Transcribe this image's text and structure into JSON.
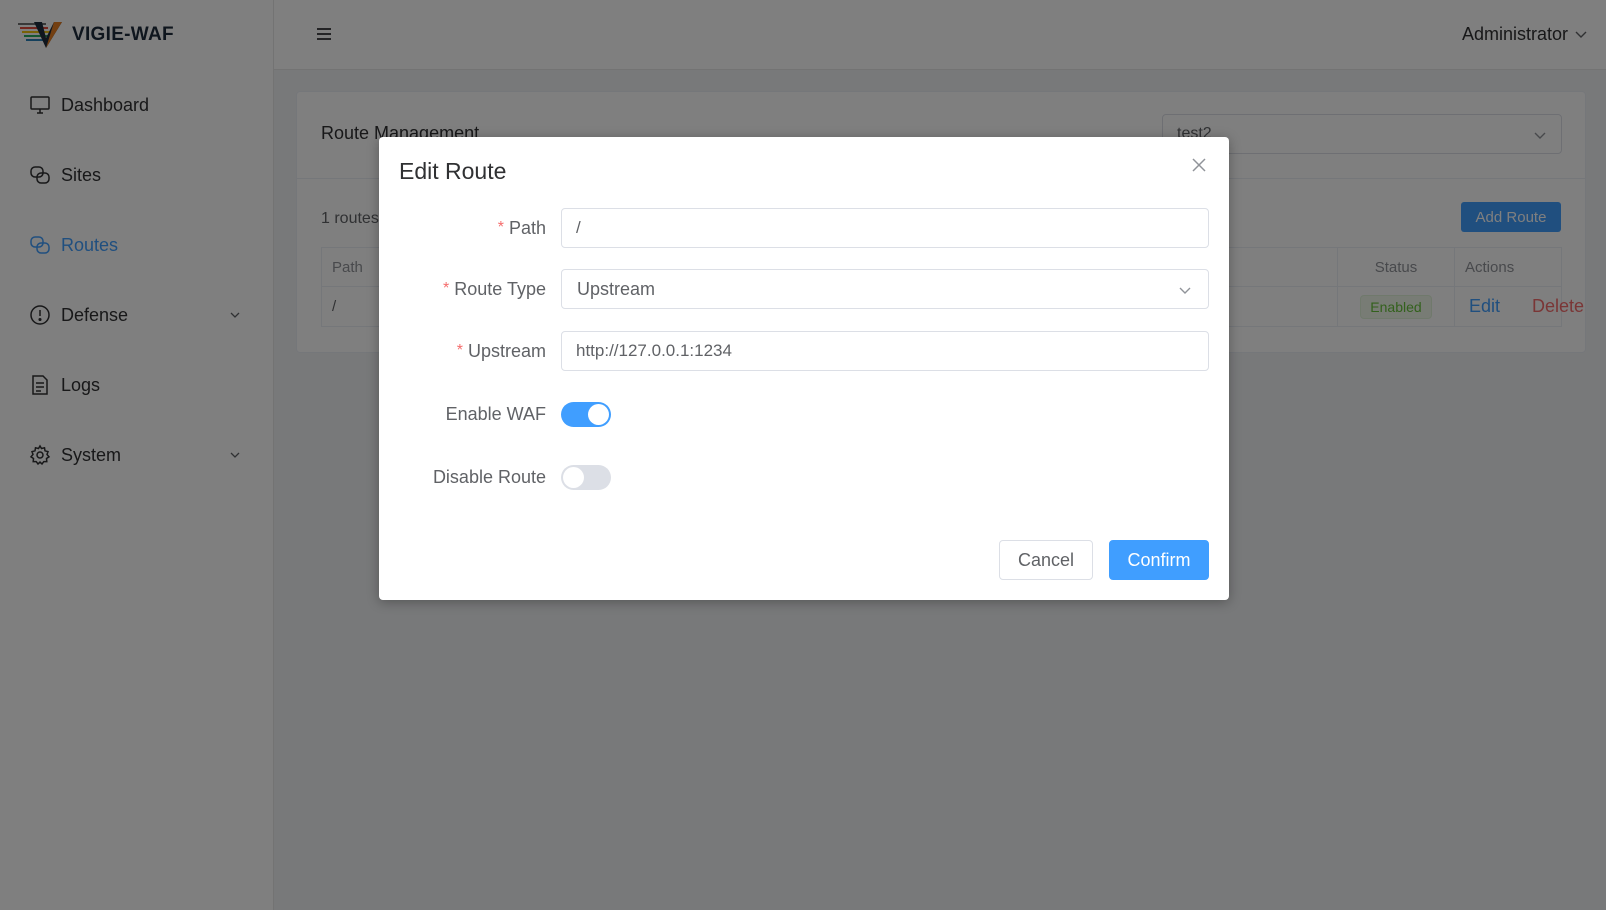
{
  "app": {
    "name": "VIGIE-WAF"
  },
  "sidebar": {
    "items": [
      {
        "label": "Dashboard",
        "icon": "monitor-icon"
      },
      {
        "label": "Sites",
        "icon": "sites-icon"
      },
      {
        "label": "Routes",
        "icon": "routes-icon",
        "active": true
      },
      {
        "label": "Defense",
        "icon": "alert-circle-icon",
        "expandable": true
      },
      {
        "label": "Logs",
        "icon": "document-icon"
      },
      {
        "label": "System",
        "icon": "gear-icon",
        "expandable": true
      }
    ]
  },
  "header": {
    "user_label": "Administrator"
  },
  "page": {
    "title": "Route Management",
    "site_select_value": "test2",
    "route_count_text": "1 routes",
    "add_button_label": "Add Route",
    "table": {
      "columns": {
        "path": "Path",
        "status": "Status",
        "actions": "Actions"
      },
      "rows": [
        {
          "path": "/",
          "status": "Enabled",
          "edit_label": "Edit",
          "delete_label": "Delete"
        }
      ]
    }
  },
  "dialog": {
    "title": "Edit Route",
    "fields": {
      "path": {
        "label": "Path",
        "value": "/"
      },
      "route_type": {
        "label": "Route Type",
        "value": "Upstream"
      },
      "upstream": {
        "label": "Upstream",
        "value": "http://127.0.0.1:1234"
      },
      "enable_waf": {
        "label": "Enable WAF",
        "on": true
      },
      "disable_route": {
        "label": "Disable Route",
        "on": false
      }
    },
    "required_mark": "*",
    "cancel_label": "Cancel",
    "confirm_label": "Confirm"
  },
  "colors": {
    "primary": "#409eff",
    "danger": "#f56c6c",
    "success": "#67c23a"
  }
}
